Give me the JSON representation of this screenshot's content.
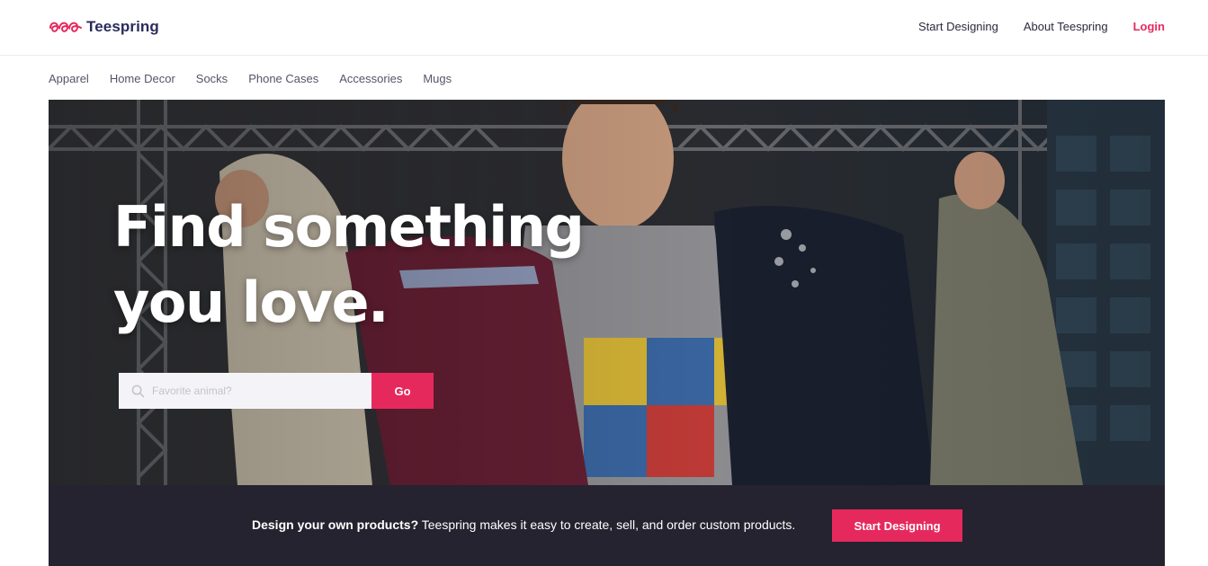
{
  "header": {
    "brand": "Teespring",
    "nav": {
      "start_designing": "Start Designing",
      "about": "About Teespring",
      "login": "Login"
    }
  },
  "categories": [
    "Apparel",
    "Home Decor",
    "Socks",
    "Phone Cases",
    "Accessories",
    "Mugs"
  ],
  "hero": {
    "title_line1": "Find something",
    "title_line2": "you love.",
    "search": {
      "placeholder": "Favorite animal?",
      "value": "",
      "button_label": "Go"
    }
  },
  "promo": {
    "bold_text": "Design your own products?",
    "text": " Teespring makes it easy to create, sell, and order custom products.",
    "button_label": "Start Designing"
  },
  "colors": {
    "accent": "#e6295d",
    "brand_text": "#2a2b5c",
    "promo_bg": "#25232f"
  },
  "icons": {
    "logo": "teespring-swirl-logo",
    "search": "search-icon"
  }
}
